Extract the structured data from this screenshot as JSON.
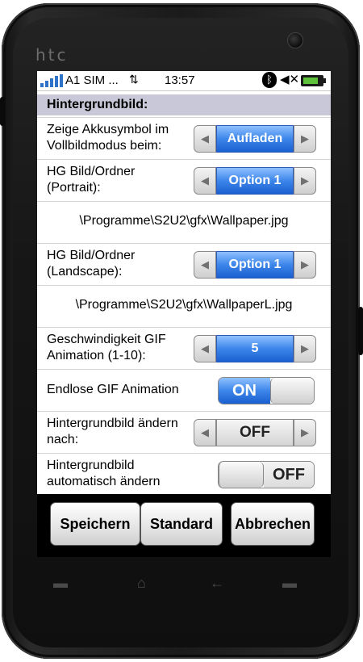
{
  "device": {
    "brand": "htc"
  },
  "statusbar": {
    "carrier": "A1 SIM ...",
    "time": "13:57",
    "bluetooth_icon": "bluetooth-icon",
    "volume_icon": "speaker-mute-icon",
    "battery_icon": "battery-charging-icon"
  },
  "section_title": "Hintergrundbild:",
  "rows": [
    {
      "label": "Zeige Akkusymbol im Vollbildmodus beim:",
      "value": "Aufladen"
    },
    {
      "label": "HG Bild/Ordner (Portrait):",
      "value": "Option 1"
    },
    {
      "path": "\\Programme\\S2U2\\gfx\\Wallpaper.jpg"
    },
    {
      "label": "HG Bild/Ordner (Landscape):",
      "value": "Option 1"
    },
    {
      "path": "\\Programme\\S2U2\\gfx\\WallpaperL.jpg"
    },
    {
      "label": "Geschwindigkeit GIF Animation (1-10):",
      "value": "5"
    },
    {
      "label": "Endlose GIF Animation",
      "toggle": "ON"
    },
    {
      "label": "Hintergrundbild ändern nach:",
      "value": "OFF"
    },
    {
      "label": "Hintergrundbild automatisch ändern",
      "toggle": "OFF"
    }
  ],
  "buttons": {
    "save": "Speichern",
    "default": "Standard",
    "cancel": "Abbrechen"
  },
  "colors": {
    "accent_blue": "#3d86ea",
    "section_bg": "#c8c8d8",
    "battery_green": "#5ec33a"
  }
}
